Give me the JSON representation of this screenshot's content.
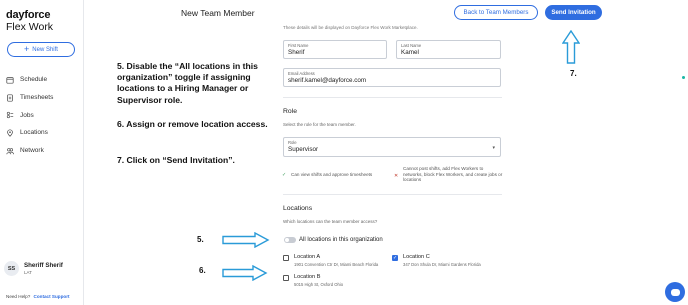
{
  "brand": {
    "line1": "dayforce",
    "line2": "Flex Work"
  },
  "sidebar": {
    "new_shift_label": "New Shift",
    "items": [
      {
        "label": "Schedule",
        "icon": "calendar-icon"
      },
      {
        "label": "Timesheets",
        "icon": "timesheet-icon"
      },
      {
        "label": "Jobs",
        "icon": "jobs-icon"
      },
      {
        "label": "Locations",
        "icon": "location-pin-icon"
      },
      {
        "label": "Network",
        "icon": "network-icon"
      }
    ],
    "user": {
      "initials": "SS",
      "name": "Sheriff Sherif",
      "role": "LAT"
    },
    "help_text": "Need Help?",
    "help_link": "Contact Support"
  },
  "header": {
    "title": "New Team Member",
    "back_label": "Back to Team Members",
    "send_label": "Send Invitation"
  },
  "form": {
    "top_note": "These details will be displayed on Dayforce Flex Work Marketplace.",
    "first_name": {
      "label": "First Name",
      "value": "Sherif"
    },
    "last_name": {
      "label": "Last Name",
      "value": "Kamel"
    },
    "email": {
      "label": "Email Address",
      "value": "sherif.kamel@dayforce.com"
    },
    "role_section": {
      "title": "Role",
      "desc": "Select the role for the team member.",
      "select_label": "Role",
      "select_value": "Supervisor",
      "can": "Can view shifts and approve timesheets",
      "cannot": "Cannot post shifts, add Flex Workers to networks, block Flex Workers, and create jobs or locations"
    },
    "locations_section": {
      "title": "Locations",
      "desc": "Which locations can the team member access?",
      "toggle_label": "All locations in this organization",
      "locations": [
        {
          "name": "Location A",
          "address": "1901 Convention Ctr Dr, Miami Beach Florida",
          "checked": false
        },
        {
          "name": "Location C",
          "address": "347 Don Shula Dr, Miami Gardens Florida",
          "checked": true
        },
        {
          "name": "Location B",
          "address": "5015 High St, Oxford Ohio",
          "checked": false
        }
      ]
    }
  },
  "annotations": {
    "step5": "5. Disable the “All locations in this organization” toggle if assigning locations to a Hiring Manager or Supervisor role.",
    "step6": "6. Assign or remove location access.",
    "step7": "7. Click on “Send Invitation”.",
    "num5": "5.",
    "num6": "6.",
    "num7": "7."
  },
  "colors": {
    "accent": "#2f6de0",
    "arrow": "#2a9bd8"
  }
}
